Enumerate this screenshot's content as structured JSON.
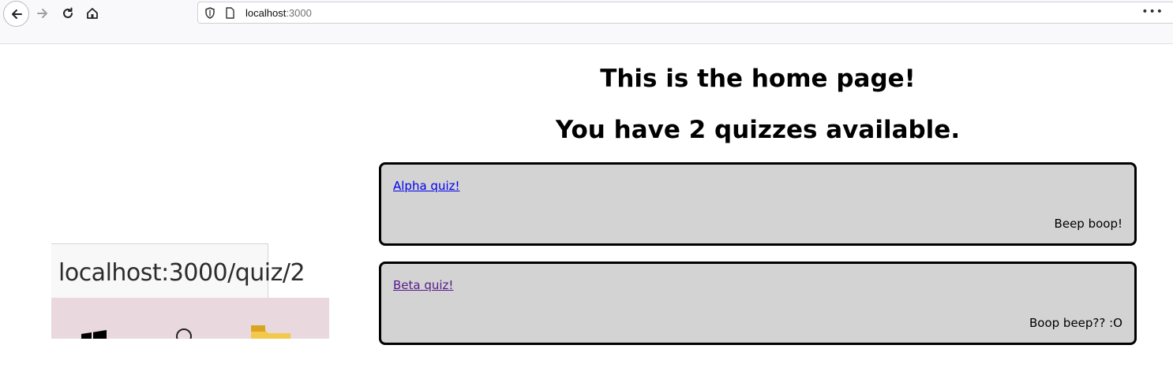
{
  "browser": {
    "url_host": "localhost",
    "url_port": ":3000",
    "menu_glyph": "•••",
    "icons": [
      "back-arrow-icon",
      "forward-arrow-icon",
      "reload-icon",
      "home-icon",
      "shield-icon",
      "page-icon",
      "more-icon"
    ]
  },
  "page": {
    "title": "This is the home page!",
    "subtitle": "You have 2 quizzes available.",
    "quizzes": [
      {
        "link": "Alpha quiz!",
        "description": "Beep boop!",
        "visited": false
      },
      {
        "link": "Beta quiz!",
        "description": "Boop beep?? :O",
        "visited": true
      }
    ],
    "colors": {
      "card_bg": "#d3d3d3",
      "link_unvisited": "#0000ee",
      "link_visited": "#551a8b"
    }
  },
  "overlay": {
    "tooltip_url": "localhost:3000/quiz/2",
    "taskbar_icons": [
      "windows-logo-icon",
      "search-icon",
      "folder-icon"
    ]
  }
}
